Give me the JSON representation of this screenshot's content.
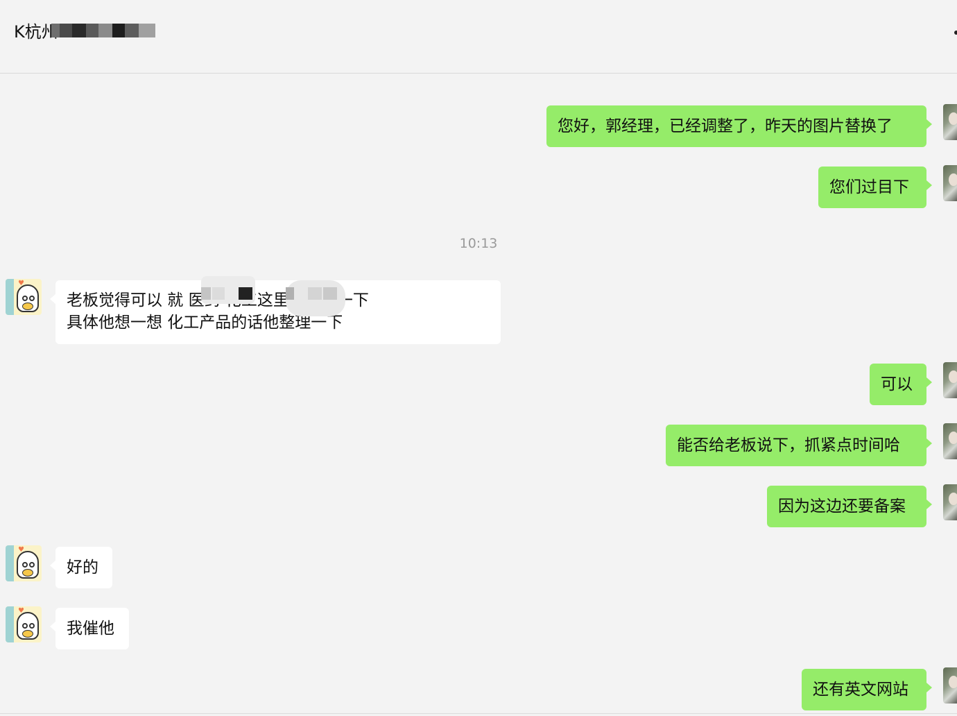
{
  "header": {
    "title": "K杭州",
    "more_icon": "more-dots-icon"
  },
  "timestamp": "10:13",
  "messages": [
    {
      "side": "out",
      "text": "您好，郭经理，已经调整了，昨天的图片替换了"
    },
    {
      "side": "out",
      "text": "您们过目下"
    },
    {
      "side": "in",
      "line1": "老板觉得可以   就    医药      化工这里要调整一下",
      "line2": "具体他想一想 化工产品的话他整理一下"
    },
    {
      "side": "out",
      "text": "可以"
    },
    {
      "side": "out",
      "text": "能否给老板说下，抓紧点时间哈"
    },
    {
      "side": "out",
      "text": "因为这边还要备案"
    },
    {
      "side": "in",
      "text": "好的"
    },
    {
      "side": "in",
      "text": "我催他"
    },
    {
      "side": "out",
      "text": "还有英文网站"
    }
  ],
  "colors": {
    "outgoing_bubble": "#95ec69",
    "incoming_bubble": "#ffffff",
    "background": "#f3f3f3"
  }
}
